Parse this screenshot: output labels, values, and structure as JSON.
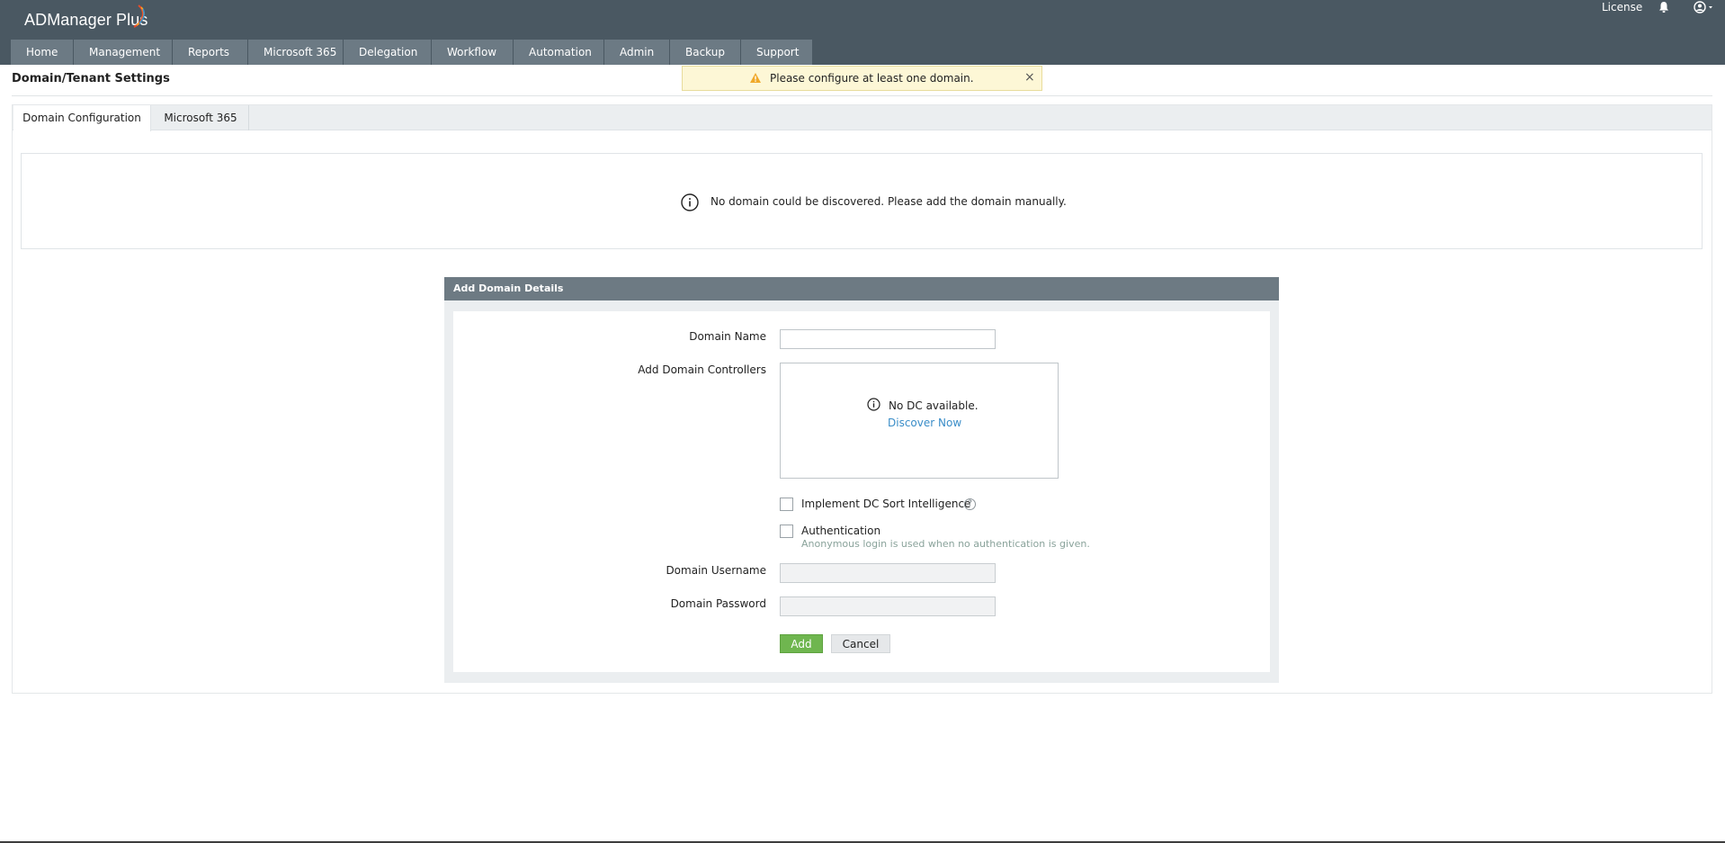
{
  "header": {
    "logo_text": "ADManager Plus",
    "license_label": "License",
    "icons": [
      "bell-icon",
      "user-icon"
    ]
  },
  "nav": {
    "items": [
      {
        "label": "Home"
      },
      {
        "label": "Management"
      },
      {
        "label": "Reports"
      },
      {
        "label": "Microsoft 365"
      },
      {
        "label": "Delegation"
      },
      {
        "label": "Workflow"
      },
      {
        "label": "Automation"
      },
      {
        "label": "Admin"
      },
      {
        "label": "Backup"
      },
      {
        "label": "Support"
      }
    ]
  },
  "page": {
    "title": "Domain/Tenant Settings"
  },
  "alert": {
    "message": "Please configure at least one domain.",
    "close_glyph": "×"
  },
  "tabs": [
    {
      "label": "Domain Configuration",
      "active": true
    },
    {
      "label": "Microsoft 365",
      "active": false
    }
  ],
  "info": {
    "message": "No domain could be discovered. Please add the domain manually."
  },
  "form": {
    "header": "Add Domain Details",
    "domain_name_label": "Domain Name",
    "domain_name_value": "",
    "dc_label": "Add Domain Controllers",
    "dc_empty_text": "No DC available.",
    "dc_discover_link": "Discover Now",
    "sort_intel_label": "Implement DC Sort Intelligence",
    "auth_label": "Authentication",
    "auth_hint": "Anonymous login is used when no authentication is given.",
    "username_label": "Domain Username",
    "username_value": "",
    "password_label": "Domain Password",
    "password_value": "",
    "add_button": "Add",
    "cancel_button": "Cancel",
    "help_glyph": "?"
  },
  "colors": {
    "topbar": "#4a5862",
    "nav_item": "#6c7a84",
    "card_header": "#6d7a83",
    "add_button": "#6fb64f",
    "link": "#3a8dc8",
    "alert_bg": "#fdf7d6"
  }
}
